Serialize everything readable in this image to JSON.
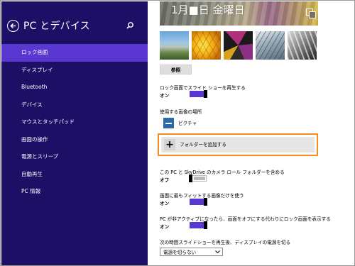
{
  "sidebar": {
    "title": "PC とデバイス",
    "items": [
      {
        "label": "ロック画面",
        "active": true
      },
      {
        "label": "ディスプレイ"
      },
      {
        "label": "Bluetooth"
      },
      {
        "label": "デバイス"
      },
      {
        "label": "マウスとタッチパッド"
      },
      {
        "label": "画面の操作"
      },
      {
        "label": "電源とスリープ"
      },
      {
        "label": "自動再生"
      },
      {
        "label": "PC 情報"
      }
    ]
  },
  "main": {
    "preview_date": "1月■日 金曜日",
    "browse_label": "参照",
    "slideshow": {
      "label": "ロック画面でスライド ショーを再生する",
      "state": "オン"
    },
    "locations_label": "使用する画像の場所",
    "folder_item": "ピクチャ",
    "add_folder_label": "フォルダーを追加する",
    "camera_roll": {
      "label": "この PC と SkyDrive のカメラ ロール フォルダーを含める",
      "state": "オフ"
    },
    "fit_images": {
      "label": "画面に最もフィットする画像だけを使う",
      "state": "オン"
    },
    "inactive_lock": {
      "label": "PC が非アクティブになったら、画面をオフにする代わりにロック画面を表示する",
      "state": "オン"
    },
    "power_off": {
      "label": "次の時間スライドショーを再生後、ディスプレイの電源を切る",
      "selected": "電源を切らない"
    }
  },
  "colors": {
    "sidebar_bg": "#1d0f66",
    "active_item": "#5a37d1",
    "toggle_on": "#5a37d1",
    "highlight_frame": "#f28d1e"
  }
}
